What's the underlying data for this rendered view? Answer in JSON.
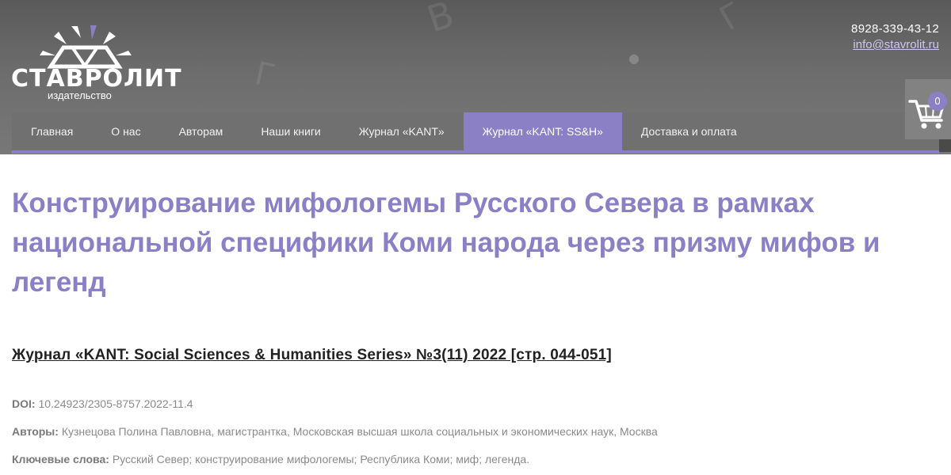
{
  "header": {
    "logo_text": "СТАВРОЛИТ",
    "logo_subtitle": "издательство",
    "phone": "8928-339-43-12",
    "email": "info@stavrolit.ru"
  },
  "nav": {
    "items": [
      {
        "label": "Главная"
      },
      {
        "label": "О нас"
      },
      {
        "label": "Авторам"
      },
      {
        "label": "Наши книги"
      },
      {
        "label": "Журнал «KANT»"
      },
      {
        "label": "Журнал «KANT: SS&H»",
        "active": true
      },
      {
        "label": "Доставка и оплата"
      }
    ]
  },
  "cart": {
    "count": "0",
    "icon": "shopping-cart-icon"
  },
  "article": {
    "title": "Конструирование мифологемы Русского Севера в рамках национальной специфики Коми народа через призму мифов и легенд",
    "journal_link": "Журнал «KANT: Social Sciences & Humanities Series» №3(11) 2022 [стр. 044-051]",
    "doi_label": "DOI:",
    "doi_value": "10.24923/2305-8757.2022-11.4",
    "authors_label": "Авторы:",
    "authors_value": "Кузнецова Полина Павловна, магистрантка, Московская высшая школа социальных и экономических наук, Москва",
    "keywords_label": "Ключевые слова:",
    "keywords_value": "Русский Север; конструирование мифологемы; Республика Коми; миф; легенда."
  },
  "colors": {
    "accent": "#8b80c6",
    "header_bg": "#6c6c6c",
    "nav_bg": "#707070"
  }
}
